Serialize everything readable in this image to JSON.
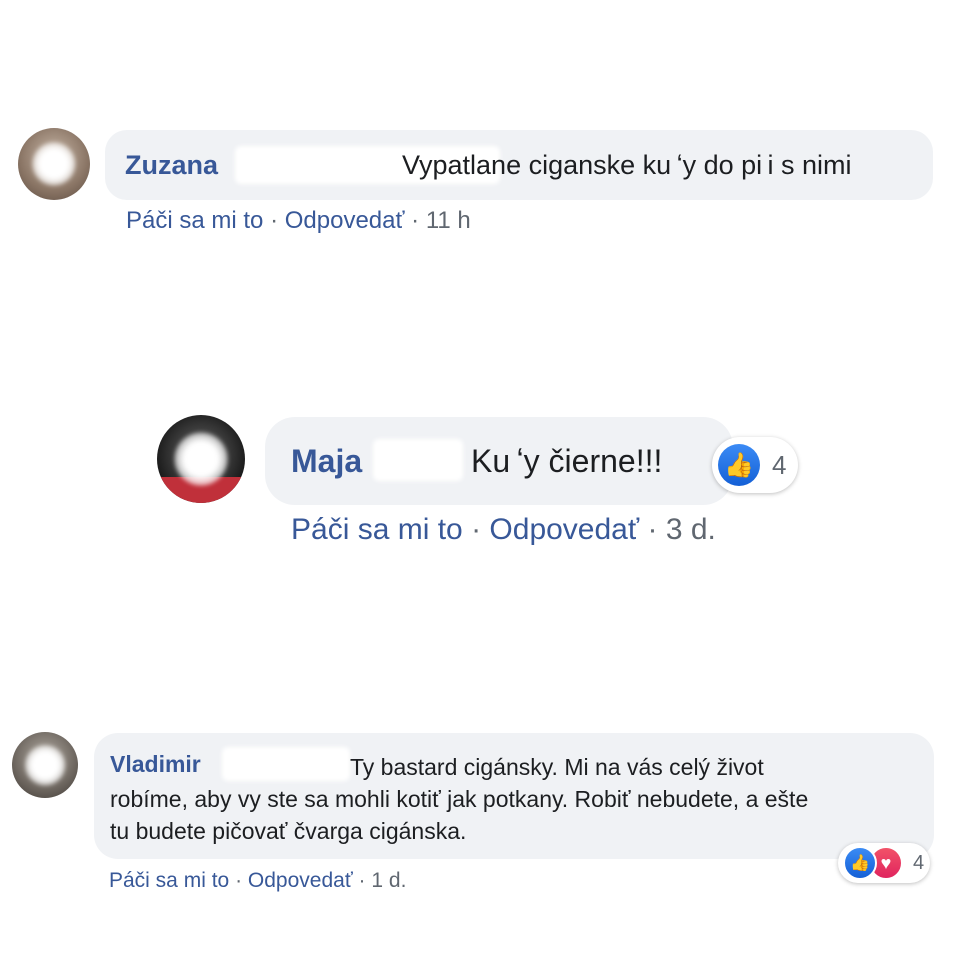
{
  "colors": {
    "author": "#385898",
    "bubble": "#f0f2f5",
    "meta": "#606770",
    "like": "#1877f2",
    "love": "#f02849"
  },
  "comments": [
    {
      "author": "Zuzana",
      "text": "Vypatlane ciganske ku ʻy do pi i s nimi",
      "actions": {
        "like": "Páči sa mi to",
        "sep1": "·",
        "reply": "Odpovedať",
        "sep2": "·",
        "time": "11 h"
      },
      "avatar_icon": "blurred-avatar"
    },
    {
      "author": "Maja",
      "text": "Ku ʻy čierne!!!",
      "actions": {
        "like": "Páči sa mi to",
        "sep1": "·",
        "reply": "Odpovedať",
        "sep2": "·",
        "time": "3 d."
      },
      "reactions": {
        "icons": [
          "like-icon"
        ],
        "count": "4"
      },
      "avatar_icon": "blurred-avatar"
    },
    {
      "author": "Vladimir",
      "text_lines": [
        "Ty bastard cigánsky. Mi na vás celý život",
        "robíme, aby vy ste sa mohli kotiť jak potkany. Robiť nebudete, a ešte",
        "tu budete pičovať čvarga cigánska."
      ],
      "actions": {
        "like": "Páči sa mi to",
        "sep1": "·",
        "reply": "Odpovedať",
        "sep2": "·",
        "time": "1 d."
      },
      "reactions": {
        "icons": [
          "like-icon",
          "love-icon"
        ],
        "count": "4"
      },
      "avatar_icon": "blurred-avatar"
    }
  ]
}
